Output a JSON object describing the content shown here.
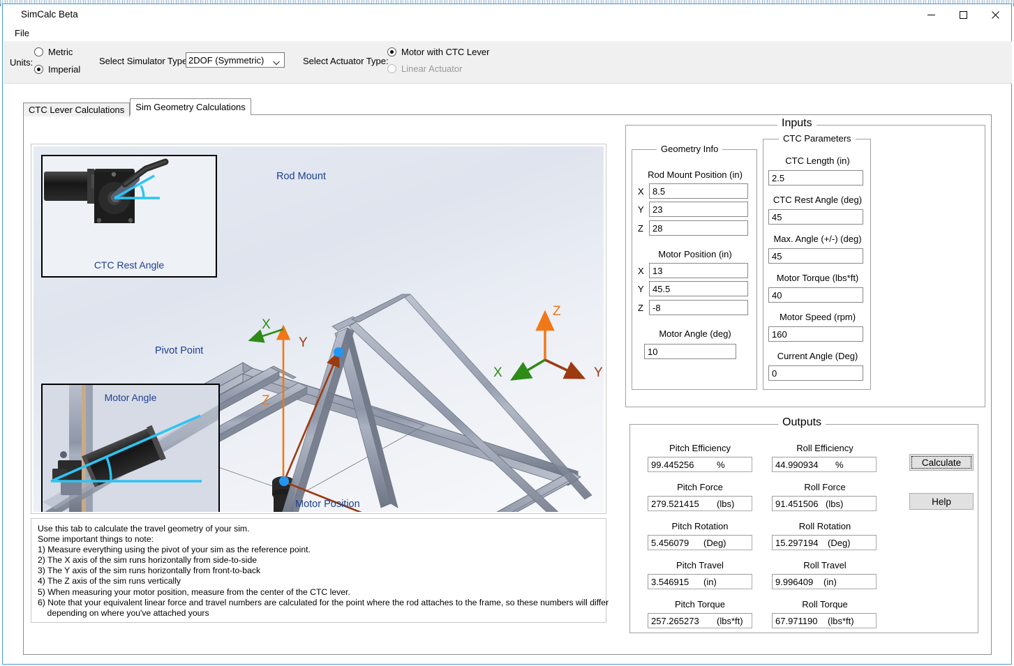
{
  "window": {
    "title": "SimCalc Beta",
    "minimize_label": "minimize",
    "maximize_label": "maximize",
    "close_label": "close"
  },
  "menubar": {
    "items": [
      "File"
    ]
  },
  "toolbar": {
    "units_label": "Units:",
    "units_options": [
      "Metric",
      "Imperial"
    ],
    "units_selected": "Imperial",
    "simulator_label": "Select Simulator Type:",
    "simulator_value": "2DOF (Symmetric)",
    "simulator_options": [
      "2DOF (Symmetric)"
    ],
    "actuator_label": "Select Actuator Type:",
    "actuator_options": [
      "Motor with CTC Lever",
      "Linear Actuator"
    ],
    "actuator_selected": "Motor with CTC Lever",
    "actuator_disabled": "Linear Actuator"
  },
  "tabs": [
    {
      "label": "CTC Lever Calculations",
      "active": false
    },
    {
      "label": "Sim Geometry Calculations",
      "active": true
    }
  ],
  "diagram": {
    "labels": {
      "rod_mount": "Rod Mount",
      "pivot_point": "Pivot Point",
      "motor_position": "Motor Position",
      "ctc_rest_angle": "CTC Rest Angle",
      "motor_angle": "Motor Angle"
    },
    "axes": {
      "x": "X",
      "y": "Y",
      "z": "Z"
    },
    "colors": {
      "axis_x": "#2e8b18",
      "axis_y": "#9c3a10",
      "axis_z": "#f07818",
      "label_blue": "#1f3f8f",
      "highlight_cyan": "#2ec4f2",
      "node_blue": "#2196f3"
    }
  },
  "notes": {
    "lines": [
      "Use this tab to calculate the travel geometry of your sim.",
      "Some important things to note:",
      "1) Measure everything using the pivot of your sim as the reference point.",
      "2) The X axis of the sim runs horizontally from side-to-side",
      "3) The Y axis of the sim runs horizontally from front-to-back",
      "4) The Z axis of the sim runs vertically",
      "5) When measuring your motor position, measure from the center of the CTC lever.",
      "6) Note that your equivalent linear force and travel numbers are calculated for the point where the rod attaches to the frame, so these numbers will differ",
      "    depending on where you've attached yours"
    ]
  },
  "inputs": {
    "title": "Inputs",
    "geometry": {
      "title": "Geometry Info",
      "rod_mount_label": "Rod Mount Position  (in)",
      "rod_mount": {
        "x_label": "X",
        "x": "8.5",
        "y_label": "Y",
        "y": "23",
        "z_label": "Z",
        "z": "28"
      },
      "motor_position_label": "Motor Position  (in)",
      "motor_position": {
        "x_label": "X",
        "x": "13",
        "y_label": "Y",
        "y": "45.5",
        "z_label": "Z",
        "z": "-8"
      },
      "motor_angle_label": "Motor Angle (deg)",
      "motor_angle": "10"
    },
    "ctc": {
      "title": "CTC Parameters",
      "fields": [
        {
          "label": "CTC Length  (in)",
          "value": "2.5"
        },
        {
          "label": "CTC Rest Angle (deg)",
          "value": "45"
        },
        {
          "label": "Max. Angle (+/-) (deg)",
          "value": "45"
        },
        {
          "label": "Motor Torque (lbs*ft)",
          "value": "40"
        },
        {
          "label": "Motor Speed (rpm)",
          "value": "160"
        },
        {
          "label": "Current Angle (Deg)",
          "value": "0"
        }
      ]
    }
  },
  "outputs": {
    "title": "Outputs",
    "pitch": [
      {
        "label": "Pitch Efficiency",
        "value": "99.445256",
        "unit": "%"
      },
      {
        "label": "Pitch Force",
        "value": "279.521415",
        "unit": "(lbs)"
      },
      {
        "label": "Pitch Rotation",
        "value": "5.456079",
        "unit": "(Deg)"
      },
      {
        "label": "Pitch Travel",
        "value": "3.546915",
        "unit": "(in)"
      },
      {
        "label": "Pitch Torque",
        "value": "257.265273",
        "unit": "(lbs*ft)"
      }
    ],
    "roll": [
      {
        "label": "Roll Efficiency",
        "value": "44.990934",
        "unit": "%"
      },
      {
        "label": "Roll Force",
        "value": "91.451506",
        "unit": "(lbs)"
      },
      {
        "label": "Roll Rotation",
        "value": "15.297194",
        "unit": "(Deg)"
      },
      {
        "label": "Roll Travel",
        "value": "9.996409",
        "unit": "(in)"
      },
      {
        "label": "Roll Torque",
        "value": "67.971190",
        "unit": "(lbs*ft)"
      }
    ],
    "calculate_label": "Calculate",
    "help_label": "Help"
  }
}
